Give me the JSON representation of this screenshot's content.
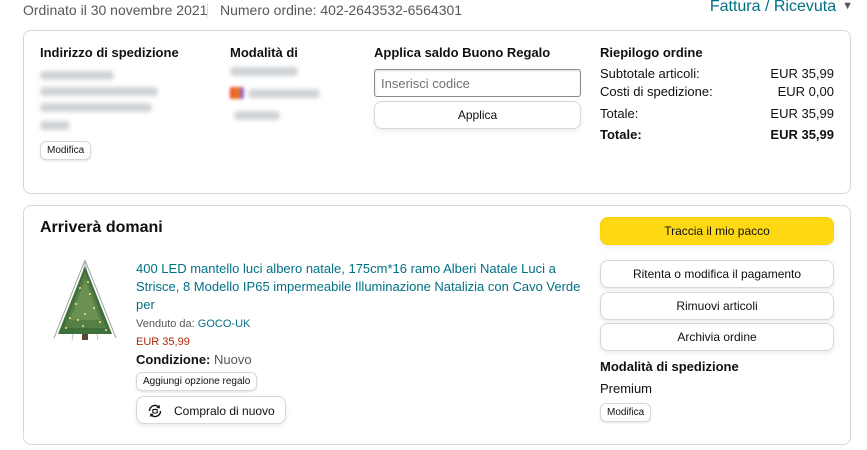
{
  "header": {
    "order_date": "Ordinato il 30 novembre 2021",
    "order_number": "Numero ordine: 402-2643532-6564301",
    "invoice_link": "Fattura / Ricevuta",
    "invoice_icon": "chevron-down-icon"
  },
  "details": {
    "shipping_address_title": "Indirizzo di spedizione",
    "shipping_address_edit": "Modifica",
    "payment_method_title": "Modalità di",
    "gift_card_title": "Applica saldo Buono Regalo",
    "gift_card_placeholder": "Inserisci codice",
    "gift_card_apply": "Applica",
    "summary_title": "Riepilogo ordine",
    "summary": {
      "subtotal_label": "Subtotale articoli:",
      "subtotal_value": "EUR 35,99",
      "shipping_label": "Costi di spedizione:",
      "shipping_value": "EUR 0,00",
      "total_label": "Totale:",
      "total_value": "EUR 35,99",
      "grand_total_label": "Totale:",
      "grand_total_value": "EUR 35,99"
    }
  },
  "shipment": {
    "arrival_title": "Arriverà domani",
    "product": {
      "title": "400 LED mantello luci albero natale, 175cm*16 ramo Alberi Natale Luci a Strisce, 8 Modello IP65 impermeabile Illuminazione Natalizia con Cavo Verde per",
      "sold_by_label": "Venduto da:",
      "seller": "GOCO-UK",
      "price": "EUR 35,99",
      "condition_label": "Condizione:",
      "condition_value": "Nuovo",
      "gift_option": "Aggiungi opzione regalo",
      "buy_again": "Compralo di nuovo",
      "buy_again_icon": "buy-again-icon"
    },
    "actions": {
      "track": "Traccia il mio pacco",
      "retry_payment": "Ritenta o modifica il pagamento",
      "remove_items": "Rimuovi articoli",
      "archive": "Archivia ordine"
    },
    "shipping_mode_title": "Modalità di spedizione",
    "shipping_mode_value": "Premium",
    "shipping_mode_edit": "Modifica"
  },
  "colors": {
    "link": "#007185",
    "price": "#b12704",
    "primary_button": "#ffd814",
    "border": "#d5d9d9"
  }
}
